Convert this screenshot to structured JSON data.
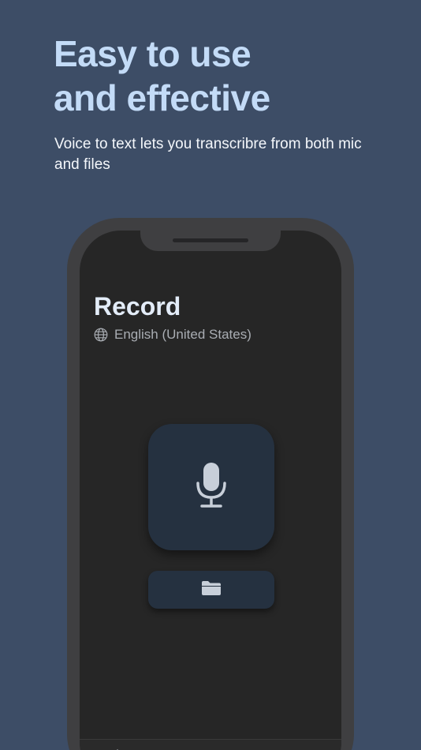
{
  "promo": {
    "headline_line1": "Easy to use",
    "headline_line2": "and effective",
    "subtitle": "Voice to text lets you transcribre  from both mic and files"
  },
  "screen": {
    "title": "Record",
    "language": "English (United States)"
  },
  "icons": {
    "language": "globe-icon",
    "record": "microphone-icon",
    "files": "folder-icon",
    "tabs": [
      "text-icon",
      "document-icon",
      "settings-icon"
    ]
  },
  "colors": {
    "background": "#3d4d66",
    "headline": "#c3dbf7",
    "button": "#253140",
    "icon": "#c8cfd9"
  }
}
